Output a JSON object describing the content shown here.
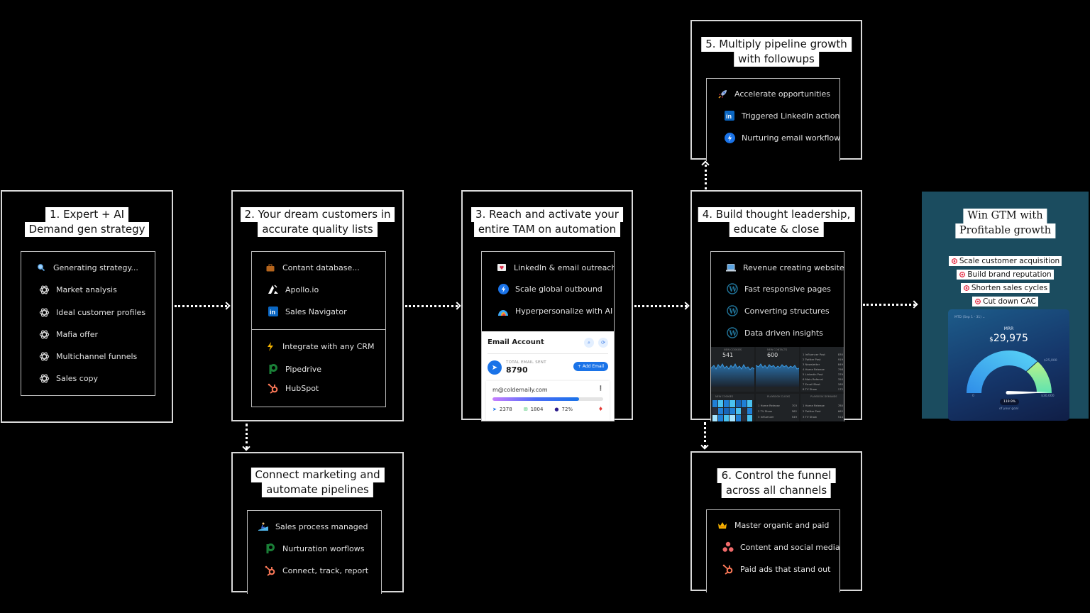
{
  "steps": {
    "s1": {
      "title": [
        "1. Expert + AI",
        "Demand gen strategy"
      ],
      "items": [
        {
          "icon": "magnifier-icon",
          "label": "Generating strategy..."
        },
        {
          "icon": "openai-icon",
          "label": "Market analysis"
        },
        {
          "icon": "openai-icon",
          "label": "Ideal customer profiles"
        },
        {
          "icon": "openai-icon",
          "label": "Mafia offer"
        },
        {
          "icon": "openai-icon",
          "label": "Multichannel funnels"
        },
        {
          "icon": "openai-icon",
          "label": "Sales copy"
        }
      ]
    },
    "s2": {
      "title": [
        "2. Your dream customers in",
        "accurate quality lists"
      ],
      "items": [
        {
          "icon": "briefcase-icon",
          "label": "Contant database..."
        },
        {
          "icon": "apollo-icon",
          "label": "Apollo.io"
        },
        {
          "icon": "linkedin-icon",
          "label": "Sales Navigator"
        },
        {
          "icon": "lightning-icon",
          "label": "Integrate with any CRM"
        },
        {
          "icon": "pipedrive-icon",
          "label": "Pipedrive"
        },
        {
          "icon": "hubspot-icon",
          "label": "HubSpot"
        }
      ]
    },
    "s3": {
      "title": [
        "3. Reach and activate your",
        "entire TAM on automation"
      ],
      "items": [
        {
          "icon": "love-letter-icon",
          "label": "LinkedIn & email outreach"
        },
        {
          "icon": "lightning-circle-icon",
          "label": "Scale global outbound"
        },
        {
          "icon": "ai-app-icon",
          "label": "Hyperpersonalize with AI"
        }
      ],
      "email_card": {
        "header": "Email Account",
        "total_label": "TOTAL EMAIL SENT",
        "total_value": "8790",
        "add_button": "+ Add Email",
        "account": "m@coldemaily.com",
        "progress_percent": 78,
        "stats": [
          {
            "icon": "send-icon",
            "value": "2378"
          },
          {
            "icon": "mail-icon",
            "value": "1804"
          },
          {
            "icon": "reply-icon",
            "value": "72%"
          }
        ]
      }
    },
    "s4": {
      "title": [
        "4. Build thought leadership,",
        "educate & close"
      ],
      "items": [
        {
          "icon": "laptop-icon",
          "label": "Revenue creating website"
        },
        {
          "icon": "wordpress-icon",
          "label": "Fast responsive pages"
        },
        {
          "icon": "wordpress-icon",
          "label": "Converting structures"
        },
        {
          "icon": "wordpress-icon",
          "label": "Data driven insights"
        }
      ],
      "dashboard": {
        "panel1_title": "NEW COOKIES",
        "panel1_value": "541",
        "panel2_title": "NEW CONTACTS",
        "panel2_value": "600",
        "table_values": [
          "830",
          "919",
          "849",
          "798",
          "379",
          "350",
          "180",
          "172"
        ],
        "bottom_left_title": "NEW COOKIES",
        "bottom_mid_title": "PLAYBOOK CLICKS",
        "bottom_mid_values": [
          "703",
          "582",
          "549"
        ],
        "bottom_right_title": "PLAYBOOK DEMANDS",
        "bottom_right_values": [
          "780",
          "662",
          "514"
        ]
      }
    },
    "s5": {
      "title": [
        "5. Multiply pipeline growth",
        "with followups"
      ],
      "items": [
        {
          "icon": "rocket-icon",
          "label": "Accelerate opportunities"
        },
        {
          "icon": "linkedin-icon",
          "label": "Triggered LinkedIn actions"
        },
        {
          "icon": "lightning-circle-icon",
          "label": "Nurturing email workflows"
        }
      ]
    },
    "s6": {
      "title": [
        "6. Control the funnel",
        "across all channels"
      ],
      "items": [
        {
          "icon": "crown-icon",
          "label": "Master organic and paid"
        },
        {
          "icon": "asana-icon",
          "label": "Content and social media"
        },
        {
          "icon": "hubspot-icon",
          "label": "Paid ads that stand out"
        }
      ]
    },
    "connect": {
      "title": [
        "Connect marketing and",
        "automate pipelines"
      ],
      "items": [
        {
          "icon": "surfer-icon",
          "label": "Sales process managed"
        },
        {
          "icon": "pipedrive-icon",
          "label": "Nurturation worflows"
        },
        {
          "icon": "hubspot-icon",
          "label": "Connect, track, report"
        }
      ]
    }
  },
  "final": {
    "title": [
      "Win GTM with",
      "Profitable growth"
    ],
    "goals": [
      "Scale customer acquisition",
      "Build brand reputation",
      "Shorten sales cycles",
      "Cut down CAC"
    ],
    "mrr": {
      "period": "MTD (Sep 1 - 31) ⌄",
      "label": "MRR",
      "currency": "$",
      "value": "29,975",
      "gauge_min": "0",
      "gauge_mark": "$25,000",
      "gauge_max": "$30,000",
      "percent": "119.9%",
      "goal_label": "of your goal"
    }
  },
  "colors": {
    "background": "#000000",
    "box_border": "#d9d9d9",
    "final_panel": "#1b4c5f",
    "linkedin": "#0a66c2",
    "hubspot": "#ff7a59",
    "pipedrive": "#1a7f37",
    "wordpress": "#21759b"
  }
}
